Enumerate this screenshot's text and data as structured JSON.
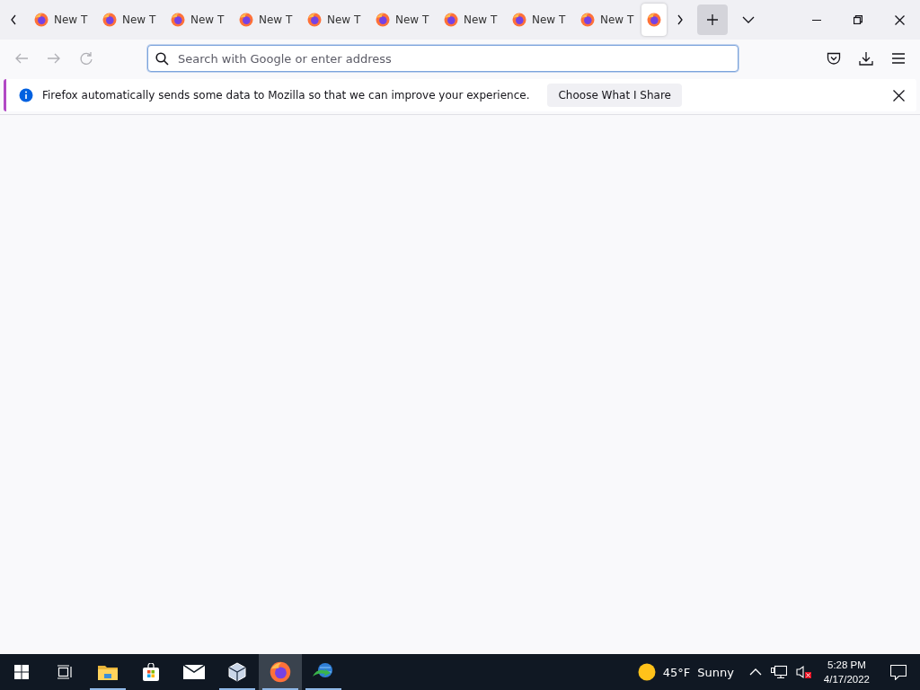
{
  "tabs": [
    {
      "label": "New T",
      "selected": false
    },
    {
      "label": "New T",
      "selected": false
    },
    {
      "label": "New T",
      "selected": false
    },
    {
      "label": "New T",
      "selected": false
    },
    {
      "label": "New T",
      "selected": false
    },
    {
      "label": "New T",
      "selected": false
    },
    {
      "label": "New T",
      "selected": false
    },
    {
      "label": "New T",
      "selected": false
    },
    {
      "label": "New T",
      "selected": false
    },
    {
      "selected": true
    }
  ],
  "address_bar": {
    "placeholder": "Search with Google or enter address"
  },
  "notification": {
    "message": "Firefox automatically sends some data to Mozilla so that we can improve your experience.",
    "button": "Choose What I Share"
  },
  "taskbar": {
    "apps": [
      {
        "kind": "start",
        "running": false,
        "selected": false
      },
      {
        "kind": "taskview",
        "running": false,
        "selected": false
      },
      {
        "kind": "explorer",
        "running": true,
        "selected": false
      },
      {
        "kind": "store",
        "running": false,
        "selected": false
      },
      {
        "kind": "mail",
        "running": false,
        "selected": false
      },
      {
        "kind": "virtualbox",
        "running": true,
        "selected": false
      },
      {
        "kind": "firefox",
        "running": true,
        "selected": true
      },
      {
        "kind": "downloader",
        "running": true,
        "selected": false
      }
    ],
    "weather": {
      "temperature": "45°F",
      "condition": "Sunny"
    },
    "time": "5:28 PM",
    "date": "4/17/2022"
  }
}
